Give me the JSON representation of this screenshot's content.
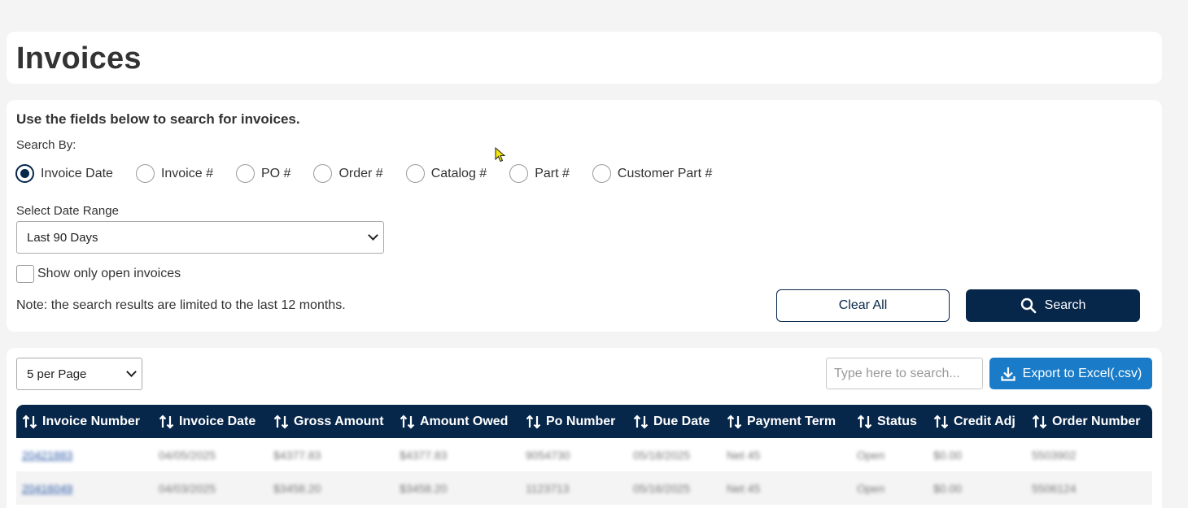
{
  "page": {
    "title": "Invoices"
  },
  "search": {
    "intro": "Use the fields below to search for invoices.",
    "search_by_label": "Search By:",
    "options": [
      {
        "label": "Invoice Date",
        "checked": true
      },
      {
        "label": "Invoice #",
        "checked": false
      },
      {
        "label": "PO #",
        "checked": false
      },
      {
        "label": "Order #",
        "checked": false
      },
      {
        "label": "Catalog #",
        "checked": false
      },
      {
        "label": "Part #",
        "checked": false
      },
      {
        "label": "Customer Part #",
        "checked": false
      }
    ],
    "range_label": "Select Date Range",
    "range_value": "Last 90 Days",
    "open_only_label": "Show only open invoices",
    "open_only_checked": false,
    "note": "Note: the search results are limited to the last 12 months.",
    "clear_label": "Clear All",
    "search_label": "Search"
  },
  "results": {
    "per_page": "5 per Page",
    "filter_placeholder": "Type here to search...",
    "export_label": "Export to Excel(.csv)",
    "columns": [
      "Invoice Number",
      "Invoice Date",
      "Gross Amount",
      "Amount Owed",
      "Po Number",
      "Due Date",
      "Payment Term",
      "Status",
      "Credit Adj",
      "Order Number"
    ],
    "rows": [
      [
        "20421883",
        "04/05/2025",
        "$4377.83",
        "$4377.83",
        "9054730",
        "05/18/2025",
        "Net 45",
        "Open",
        "$0.00",
        "5503902"
      ],
      [
        "20416049",
        "04/03/2025",
        "$3458.20",
        "$3458.20",
        "1123713",
        "05/16/2025",
        "Net 45",
        "Open",
        "$0.00",
        "5506124"
      ]
    ]
  },
  "colors": {
    "navy": "#06264a",
    "blue": "#1a7cc8",
    "background": "#f4f4f4"
  }
}
